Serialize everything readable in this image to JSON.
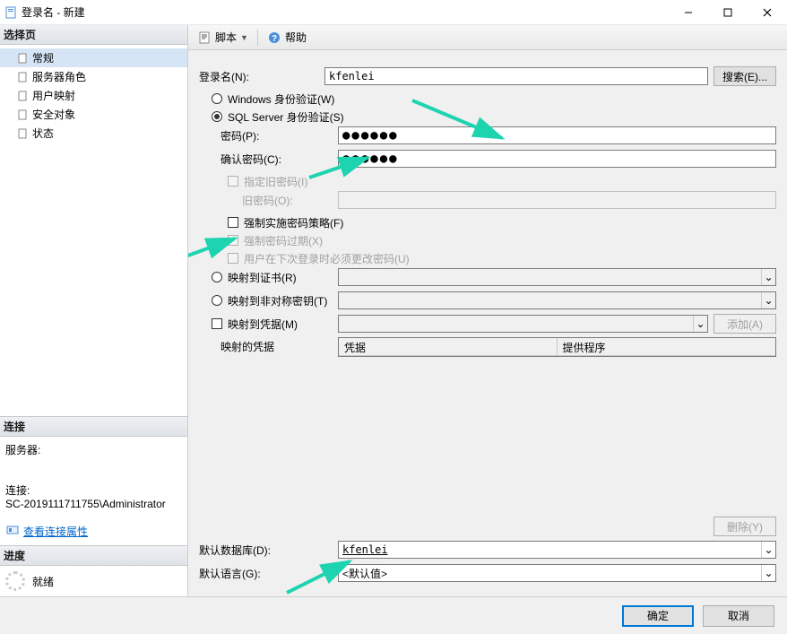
{
  "window": {
    "title": "登录名 - 新建"
  },
  "sidebar": {
    "select_page_header": "选择页",
    "pages": [
      {
        "label": "常规",
        "active": true
      },
      {
        "label": "服务器角色",
        "active": false
      },
      {
        "label": "用户映射",
        "active": false
      },
      {
        "label": "安全对象",
        "active": false
      },
      {
        "label": "状态",
        "active": false
      }
    ],
    "connection_header": "连接",
    "server_label": "服务器:",
    "server_value": "",
    "conn_label": "连接:",
    "conn_value": "SC-2019111711755\\Administrator",
    "view_conn_props": "查看连接属性",
    "progress_header": "进度",
    "status_text": "就绪"
  },
  "toolbar": {
    "script_label": "脚本",
    "help_label": "帮助"
  },
  "form": {
    "login_name_label": "登录名(N):",
    "login_name_value": "kfenlei",
    "search_btn": "搜索(E)...",
    "auth_windows": "Windows 身份验证(W)",
    "auth_sql": "SQL Server 身份验证(S)",
    "password_label": "密码(P):",
    "password_value": "●●●●●●",
    "confirm_pw_label": "确认密码(C):",
    "confirm_pw_value": "●●●●●●",
    "specify_old_pw": "指定旧密码(I)",
    "old_pw_label": "旧密码(O):",
    "enforce_policy": "强制实施密码策略(F)",
    "enforce_expire": "强制密码过期(X)",
    "must_change": "用户在下次登录时必须更改密码(U)",
    "map_cert": "映射到证书(R)",
    "map_asym": "映射到非对称密钥(T)",
    "map_cred": "映射到凭据(M)",
    "add_btn": "添加(A)",
    "mapped_creds_label": "映射的凭据",
    "grid_col1": "凭据",
    "grid_col2": "提供程序",
    "remove_btn": "删除(Y)",
    "default_db_label": "默认数据库(D):",
    "default_db_value": "kfenlei",
    "default_lang_label": "默认语言(G):",
    "default_lang_value": "<默认值>"
  },
  "footer": {
    "ok": "确定",
    "cancel": "取消"
  }
}
